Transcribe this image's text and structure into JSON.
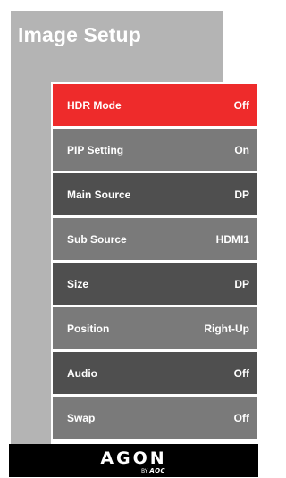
{
  "page": {
    "title": "Image Setup"
  },
  "colors": {
    "selected": "#ee2b2b",
    "dark": "#4f4f4f",
    "mid": "#7a7a7a",
    "backPanel": "#b4b4b4",
    "footer": "#000000"
  },
  "menu": {
    "items": [
      {
        "label": "HDR Mode",
        "value": "Off",
        "selected": true
      },
      {
        "label": "PIP Setting",
        "value": "On",
        "selected": false
      },
      {
        "label": "Main Source",
        "value": "DP",
        "selected": false
      },
      {
        "label": "Sub Source",
        "value": "HDMI1",
        "selected": false
      },
      {
        "label": "Size",
        "value": "DP",
        "selected": false
      },
      {
        "label": "Position",
        "value": "Right-Up",
        "selected": false
      },
      {
        "label": "Audio",
        "value": "Off",
        "selected": false
      },
      {
        "label": "Swap",
        "value": "Off",
        "selected": false
      }
    ]
  },
  "footer": {
    "brand": "AGON",
    "by": "BY",
    "maker": "AOC"
  }
}
